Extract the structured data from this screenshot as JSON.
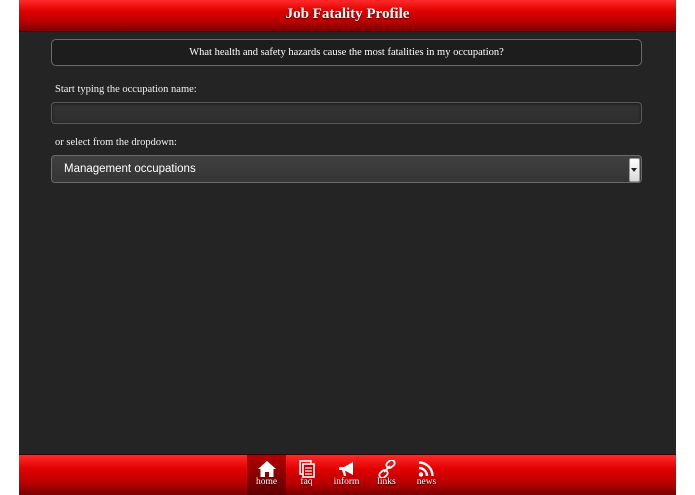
{
  "header": {
    "title": "Job Fatality Profile"
  },
  "question": {
    "text": "What health and safety hazards cause the most fatalities in my occupation?"
  },
  "search": {
    "label": "Start typing the occupation name:",
    "value": ""
  },
  "dropdown": {
    "label": "or select from the dropdown:",
    "selected": "Management occupations"
  },
  "nav": {
    "items": [
      {
        "label": "home",
        "icon": "home-icon",
        "active": true
      },
      {
        "label": "faq",
        "icon": "document-icon"
      },
      {
        "label": "inform",
        "icon": "megaphone-icon"
      },
      {
        "label": "links",
        "icon": "link-icon"
      },
      {
        "label": "news",
        "icon": "rss-icon"
      }
    ]
  },
  "colors": {
    "accent": "#e10000",
    "background": "#242424"
  }
}
